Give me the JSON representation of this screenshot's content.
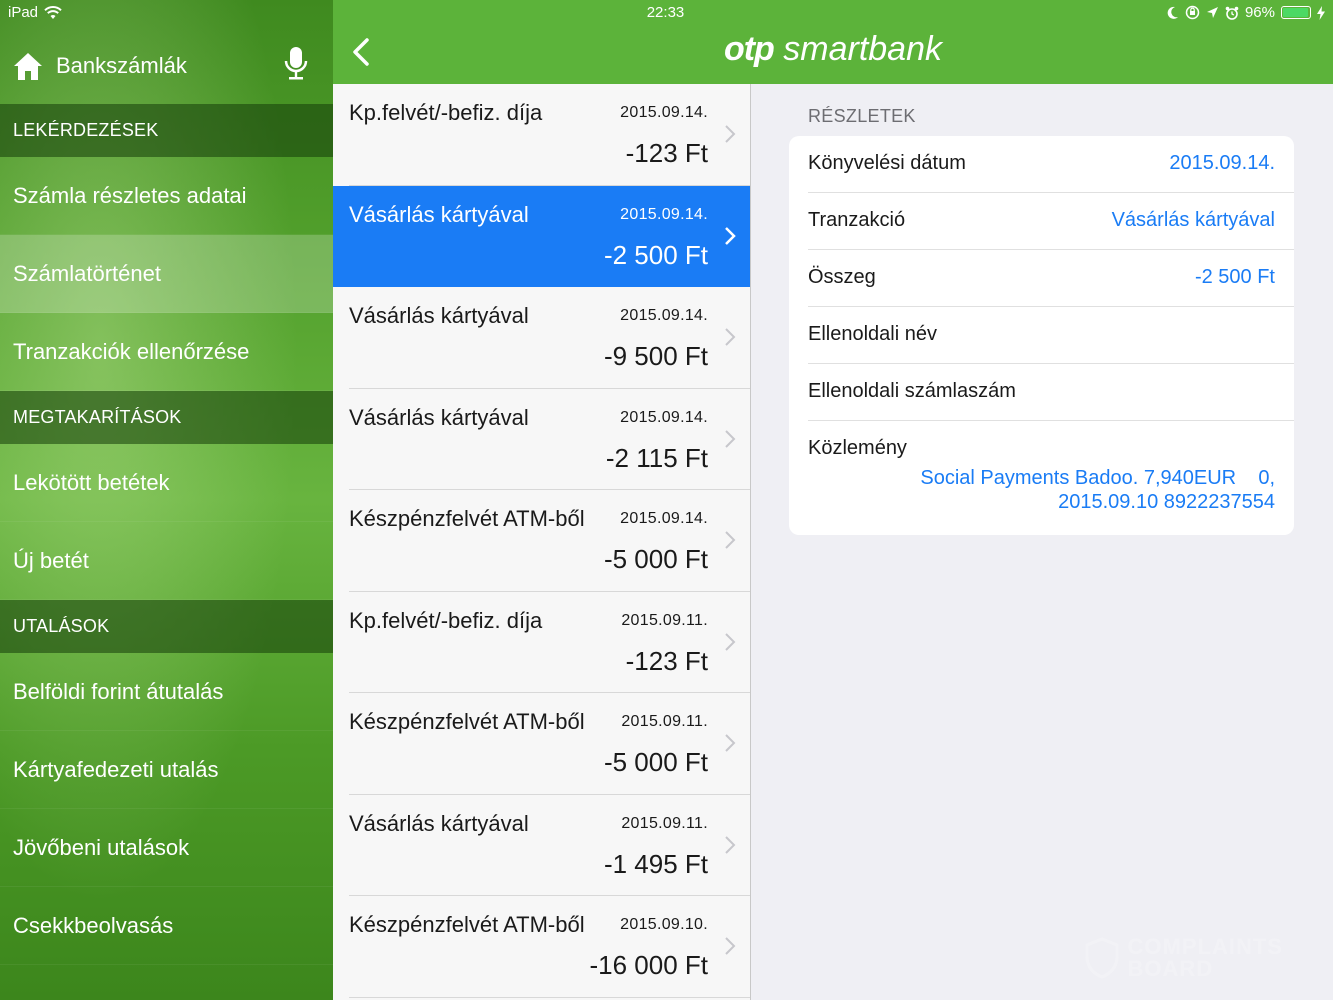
{
  "status_bar": {
    "device": "iPad",
    "time": "22:33",
    "battery": "96%"
  },
  "sidebar": {
    "header_title": "Bankszámlák",
    "sections": [
      {
        "title": "LEKÉRDEZÉSEK",
        "items": [
          "Számla részletes adatai",
          "Számlatörténet",
          "Tranzakciók ellenőrzése"
        ]
      },
      {
        "title": "MEGTAKARÍTÁSOK",
        "items": [
          "Lekötött betétek",
          "Új betét"
        ]
      },
      {
        "title": "UTALÁSOK",
        "items": [
          "Belföldi forint átutalás",
          "Kártyafedezeti utalás",
          "Jövőbeni utalások",
          "Csekkbeolvasás"
        ]
      }
    ],
    "active_item": "Számlatörténet"
  },
  "topbar": {
    "brand_bold": "otp",
    "brand_rest": " smartbank"
  },
  "transactions": [
    {
      "name": "Kp.felvét/-befiz. díja",
      "date": "2015.09.14.",
      "amount": "-123 Ft"
    },
    {
      "name": "Vásárlás kártyával",
      "date": "2015.09.14.",
      "amount": "-2 500 Ft",
      "selected": true
    },
    {
      "name": "Vásárlás kártyával",
      "date": "2015.09.14.",
      "amount": "-9 500 Ft"
    },
    {
      "name": "Vásárlás kártyával",
      "date": "2015.09.14.",
      "amount": "-2 115 Ft"
    },
    {
      "name": "Készpénzfelvét ATM-ből",
      "date": "2015.09.14.",
      "amount": "-5 000 Ft"
    },
    {
      "name": "Kp.felvét/-befiz. díja",
      "date": "2015.09.11.",
      "amount": "-123 Ft"
    },
    {
      "name": "Készpénzfelvét ATM-ből",
      "date": "2015.09.11.",
      "amount": "-5 000 Ft"
    },
    {
      "name": "Vásárlás kártyával",
      "date": "2015.09.11.",
      "amount": "-1 495 Ft"
    },
    {
      "name": "Készpénzfelvét ATM-ből",
      "date": "2015.09.10.",
      "amount": "-16 000 Ft"
    }
  ],
  "details": {
    "section_title": "RÉSZLETEK",
    "rows": [
      {
        "label": "Könyvelési dátum",
        "value": "2015.09.14."
      },
      {
        "label": "Tranzakció",
        "value": "Vásárlás kártyával"
      },
      {
        "label": "Összeg",
        "value": "-2 500 Ft"
      },
      {
        "label": "Ellenoldali név",
        "value": ""
      },
      {
        "label": "Ellenoldali számlaszám",
        "value": ""
      }
    ],
    "note_label": "Közlemény",
    "note_lines": [
      "Social Payments Badoo. 7,940EUR    0,",
      "2015.09.10 8922237554"
    ]
  },
  "watermark": {
    "line1": "COMPLAINTS",
    "line2": "BOARD"
  },
  "colors": {
    "brand_green": "#5cb33a",
    "selected_blue": "#1a7cf5",
    "value_blue": "#1a7cf5"
  }
}
